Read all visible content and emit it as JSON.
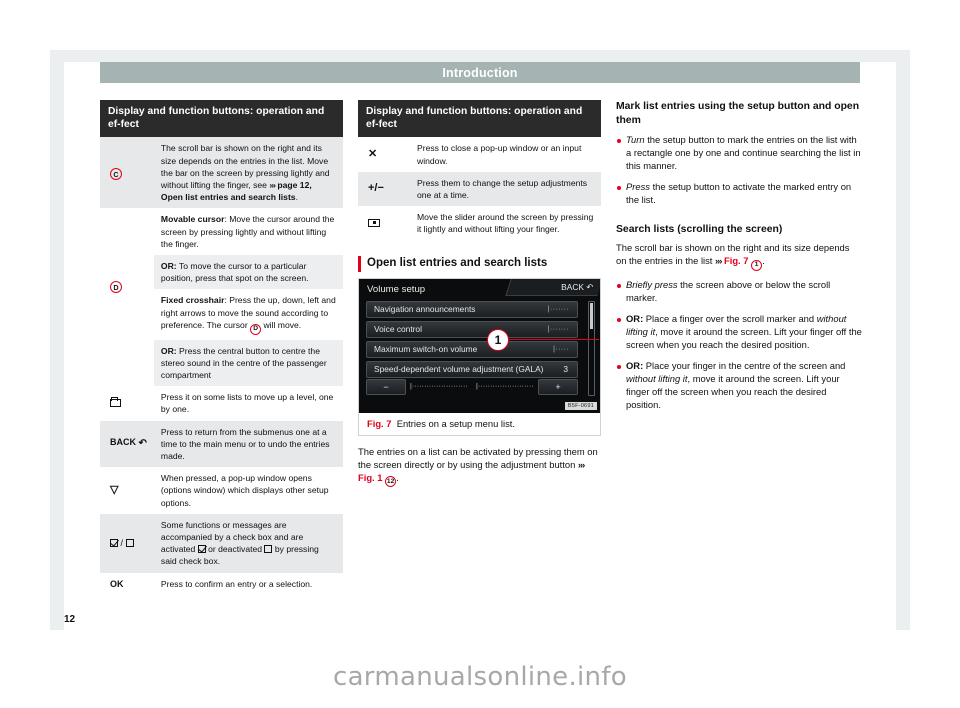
{
  "chapter": {
    "title": "Introduction"
  },
  "page_number": "12",
  "watermark": "carmanualsonline.info",
  "table1": {
    "header": "Display and function buttons: operation and ef-fect",
    "rows": [
      {
        "symbol": "C",
        "symbol_kind": "circled-letter",
        "text_html": "The scroll bar is shown on the right and its size depends on the entries in the list. Move the bar on the screen by pressing lightly and without lifting the finger, see <span class=\"arrows\">›››</span> <b>page 12, Open list entries and search lists</b>."
      },
      {
        "symbol": "D",
        "symbol_kind": "circled-letter",
        "text_html": "<b>Movable cursor</b>: Move the cursor around the screen by pressing lightly and without lifting the finger."
      },
      {
        "symbol": "",
        "text_html": "<b>OR:</b> To move the cursor to a particular position, press that spot on the screen."
      },
      {
        "symbol": "",
        "text_html": "<b>Fixed crosshair</b>: Press the up, down, left and right arrows to move the sound according to preference. The cursor <span class=\"marker marker-inline\">D</span> will move."
      },
      {
        "symbol": "",
        "text_html": "<b>OR:</b> Press the central button to centre the stereo sound in the centre of the passenger compartment"
      },
      {
        "symbol": "folder-icon",
        "symbol_kind": "icon-folder",
        "text_html": "Press it on some lists to move up a level, one by one."
      },
      {
        "symbol": "BACK",
        "symbol_kind": "back-label",
        "text_html": "Press to return from the submenus one at a time to the main menu or to undo the entries made."
      },
      {
        "symbol": "triangle-down-icon",
        "symbol_kind": "icon-triangle",
        "text_html": "When pressed, a pop-up window opens (options window) which displays other setup options."
      },
      {
        "symbol": "checkbox-pair",
        "symbol_kind": "icon-checkbox",
        "text_html": "Some functions or messages are accompanied by a check box and are activated <span class=\"cb checked\"></span> or deactivated <span class=\"cb\"></span> by pressing said check box."
      },
      {
        "symbol": "OK",
        "symbol_kind": "text",
        "text_html": "Press to confirm an entry or a selection."
      }
    ]
  },
  "table2": {
    "header": "Display and function buttons: operation and ef-fect",
    "rows": [
      {
        "symbol": "×",
        "symbol_kind": "close-icon",
        "text_html": "Press to close a pop-up window or an input window."
      },
      {
        "symbol": "+/−",
        "symbol_kind": "plus-minus",
        "text_html": "Press them to change the setup adjustments one at a time."
      },
      {
        "symbol": "slider-icon",
        "symbol_kind": "icon-slider",
        "text_html": "Move the slider around the screen by pressing it lightly and without lifting your finger."
      }
    ]
  },
  "section": {
    "heading": "Open list entries and search lists"
  },
  "figure": {
    "number_label": "Fig. 7",
    "caption": "Entries on a setup menu list.",
    "code": "B5F-0691",
    "callout": "1",
    "screen": {
      "title": "Volume setup",
      "back_label": "BACK",
      "rows": [
        {
          "label": "Navigation announcements",
          "level": "|·······"
        },
        {
          "label": "Voice control",
          "level": "|·······"
        },
        {
          "label": "Maximum switch-on volume",
          "level": "|·····"
        },
        {
          "label": "Speed-dependent volume adjustment (GALA)",
          "value": "3"
        }
      ],
      "minus_label": "−",
      "plus_label": "+",
      "bar_left": "|·······················|",
      "bar_right": "|·······················|"
    }
  },
  "figure_body": {
    "text_html": "The entries on a list can be activated by pressing them on the screen directly or by using the adjustment button <span class=\"arrows\">›››</span> <span class=\"redref\">Fig. 1</span> <span class=\"marker marker-inline\">12</span>."
  },
  "right_column": {
    "heading1": "Mark list entries using the setup button and open them",
    "bullets1": [
      {
        "text_html": "<i>Turn</i> the setup button to mark the entries on the list with a rectangle one by one and continue searching the list in this manner."
      },
      {
        "text_html": "<i>Press</i> the setup button to activate the marked entry on the list."
      }
    ],
    "heading2": "Search lists (scrolling the screen)",
    "para1_html": "The scroll bar is shown on the right and its size depends on the entries in the list <span class=\"arrows\">›››</span> <span class=\"redref\">Fig. 7</span> <span class=\"marker marker-inline\">1</span>.",
    "bullets2": [
      {
        "text_html": "<i>Briefly press</i> the screen above or below the scroll marker."
      },
      {
        "text_html": "<b>OR:</b> Place a finger over the scroll marker and <i>without lifting it</i>, move it around the screen. Lift your finger off the screen when you reach the desired position."
      },
      {
        "text_html": "<b>OR:</b> Place your finger in the centre of the screen and <i>without lifting it</i>, move it around the screen. Lift your finger off the screen when you reach the desired position."
      }
    ]
  }
}
